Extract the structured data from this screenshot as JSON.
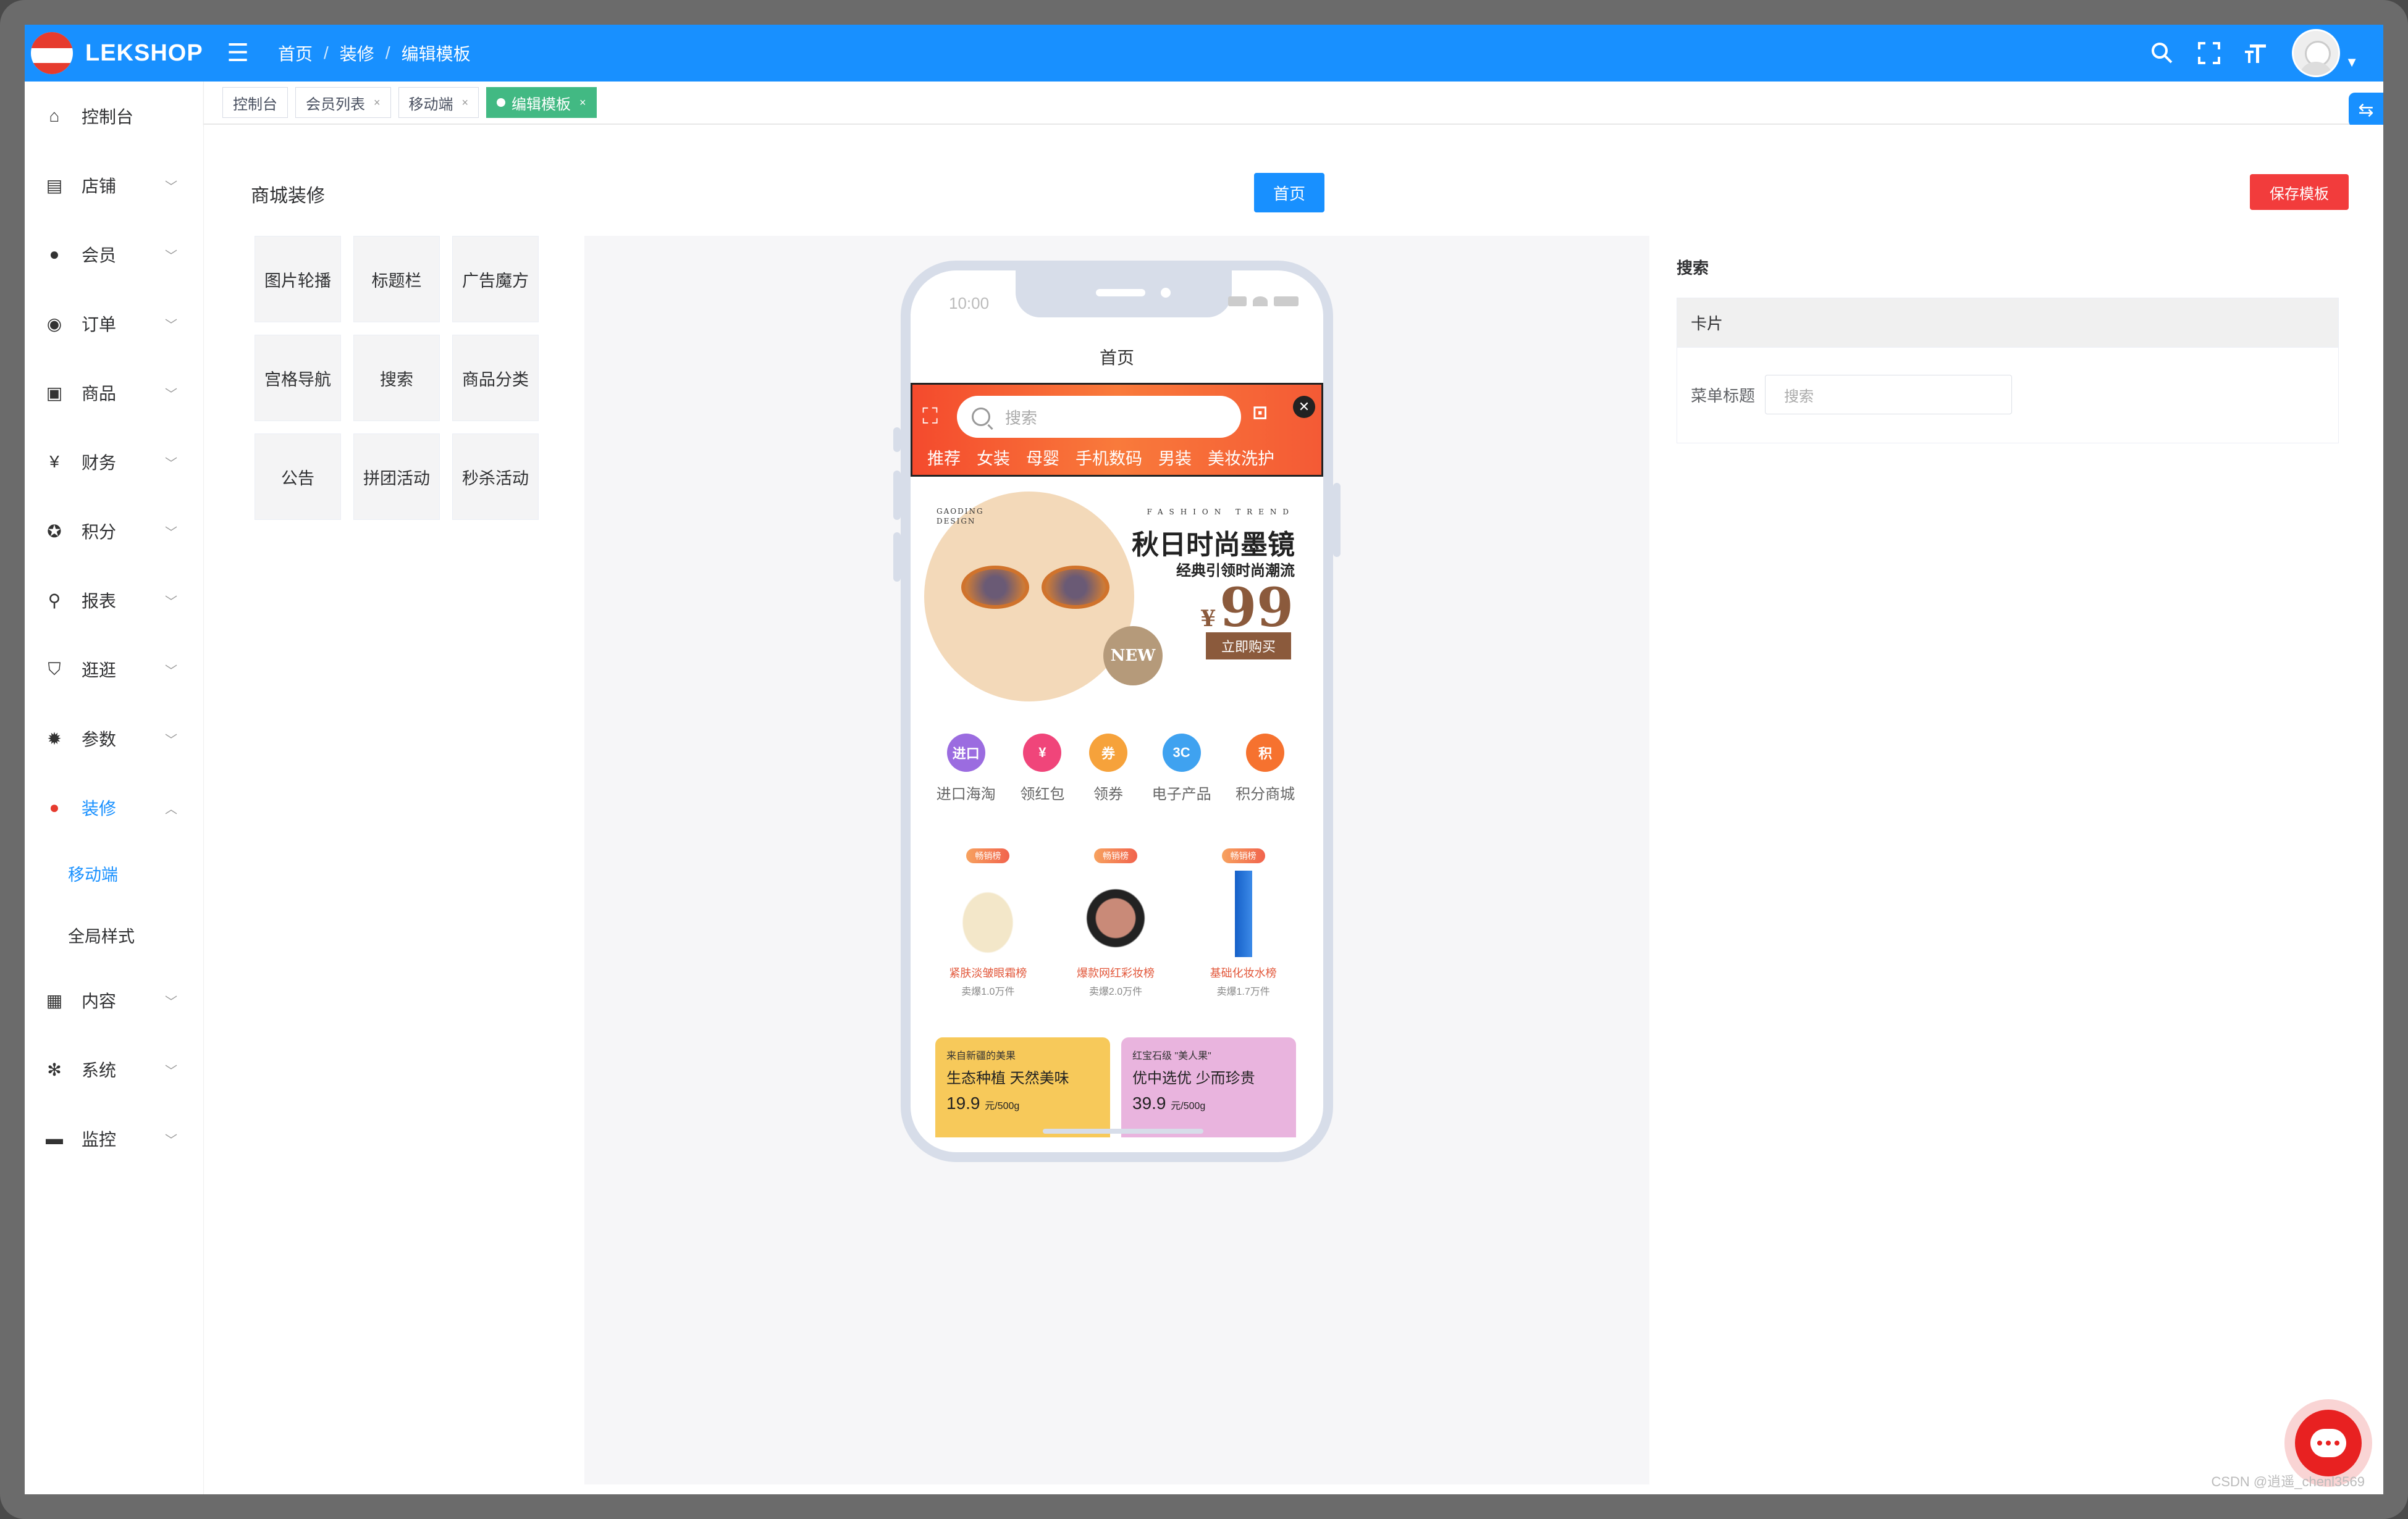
{
  "header": {
    "logo_text": "LEKSHOP",
    "breadcrumbs": [
      "首页",
      "装修",
      "编辑模板"
    ],
    "separator": "/"
  },
  "sidebar": {
    "items": [
      {
        "label": "控制台",
        "icon": "home-icon",
        "has_children": false
      },
      {
        "label": "店铺",
        "icon": "store-icon",
        "has_children": true
      },
      {
        "label": "会员",
        "icon": "user-icon",
        "has_children": true
      },
      {
        "label": "订单",
        "icon": "order-icon",
        "has_children": true
      },
      {
        "label": "商品",
        "icon": "goods-icon",
        "has_children": true
      },
      {
        "label": "财务",
        "icon": "yen-icon",
        "has_children": true
      },
      {
        "label": "积分",
        "icon": "points-icon",
        "has_children": true
      },
      {
        "label": "报表",
        "icon": "search-icon",
        "has_children": true
      },
      {
        "label": "逛逛",
        "icon": "shirt-icon",
        "has_children": true
      },
      {
        "label": "参数",
        "icon": "gear-icon",
        "has_children": true
      },
      {
        "label": "装修",
        "icon": "fire-icon",
        "has_children": true,
        "expanded": true
      }
    ],
    "sub_items": [
      {
        "label": "移动端",
        "active": true
      },
      {
        "label": "全局样式",
        "active": false
      }
    ],
    "items_after": [
      {
        "label": "内容",
        "icon": "grid-icon",
        "has_children": true
      },
      {
        "label": "系统",
        "icon": "settings-icon",
        "has_children": true
      },
      {
        "label": "监控",
        "icon": "message-icon",
        "has_children": true
      }
    ]
  },
  "tabs": [
    {
      "label": "控制台",
      "closable": false,
      "active": false
    },
    {
      "label": "会员列表",
      "closable": true,
      "active": false
    },
    {
      "label": "移动端",
      "closable": true,
      "active": false
    },
    {
      "label": "编辑模板",
      "closable": true,
      "active": true
    }
  ],
  "main": {
    "page_title": "商城装修",
    "home_button": "首页",
    "save_button": "保存模板",
    "widgets": [
      "图片轮播",
      "标题栏",
      "广告魔方",
      "宫格导航",
      "搜索",
      "商品分类",
      "公告",
      "拼团活动",
      "秒杀活动"
    ]
  },
  "phone": {
    "status_time": "10:00",
    "title": "首页",
    "search_placeholder": "搜索",
    "categories": [
      "推荐",
      "女装",
      "母婴",
      "手机数码",
      "男装",
      "美妆洗护"
    ],
    "banner": {
      "brand": "GAODING DESIGN",
      "tagline": "FASHION TREND",
      "title": "秋日时尚墨镜",
      "subtitle": "经典引领时尚潮流",
      "currency": "¥",
      "price": "99",
      "button": "立即购买",
      "badge": "NEW"
    },
    "nav": [
      {
        "label": "进口海淘",
        "icon": "import-icon",
        "glyph": "进口",
        "color": "#9b6ce0"
      },
      {
        "label": "领红包",
        "icon": "redpacket-icon",
        "glyph": "¥",
        "color": "#f0457a"
      },
      {
        "label": "领券",
        "icon": "coupon-icon",
        "glyph": "券",
        "color": "#f6a23b"
      },
      {
        "label": "电子产品",
        "icon": "electronics-icon",
        "glyph": "3C",
        "color": "#3fa2f0"
      },
      {
        "label": "积分商城",
        "icon": "points-mall-icon",
        "glyph": "积",
        "color": "#f6722f"
      }
    ],
    "ranks": [
      {
        "tag": "畅销榜",
        "name": "紧肤淡皱眼霜榜",
        "sold": "卖爆1.0万件"
      },
      {
        "tag": "畅销榜",
        "name": "爆款网红彩妆榜",
        "sold": "卖爆2.0万件"
      },
      {
        "tag": "畅销榜",
        "name": "基础化妆水榜",
        "sold": "卖爆1.7万件"
      }
    ],
    "promos": [
      {
        "from": "来自新疆的美果",
        "title": "生态种植 天然美味",
        "price": "19.9",
        "unit": "元/500g",
        "color": "#f7c95a"
      },
      {
        "from": "红宝石级 \"美人果\"",
        "title": "优中选优 少而珍贵",
        "price": "39.9",
        "unit": "元/500g",
        "color": "#e9b4de"
      }
    ]
  },
  "settings": {
    "title": "搜索",
    "card_title": "卡片",
    "field_label": "菜单标题",
    "field_placeholder": "搜索"
  },
  "watermark": "CSDN @逍遥_chenl3569",
  "colors": {
    "primary": "#1890ff",
    "danger": "#f23c3c",
    "tab_active": "#42b983"
  }
}
